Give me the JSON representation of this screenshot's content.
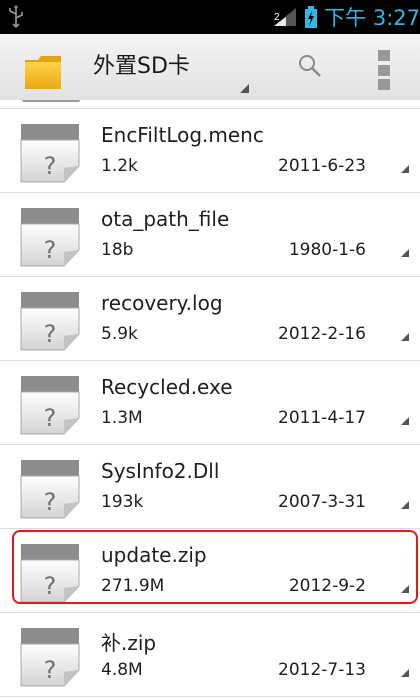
{
  "status_bar": {
    "time": "下午 3:27",
    "icons": [
      "usb-icon",
      "signal-icon",
      "battery-charging-icon"
    ],
    "accent_color": "#33b5e5"
  },
  "action_bar": {
    "title": "外置SD卡",
    "icons": [
      "folder-icon",
      "search-icon",
      "overflow-menu-icon"
    ]
  },
  "files": [
    {
      "name": "EncFiltLog.menc",
      "size": "1.2k",
      "date": "2011-6-23"
    },
    {
      "name": "ota_path_file",
      "size": "18b",
      "date": "1980-1-6"
    },
    {
      "name": "recovery.log",
      "size": "5.9k",
      "date": "2012-2-16"
    },
    {
      "name": "Recycled.exe",
      "size": "1.3M",
      "date": "2011-4-17"
    },
    {
      "name": "SysInfo2.Dll",
      "size": "193k",
      "date": "2007-3-31"
    },
    {
      "name": "update.zip",
      "size": "271.9M",
      "date": "2012-9-2",
      "highlighted": true
    },
    {
      "name": "补.zip",
      "size": "4.8M",
      "date": "2012-7-13"
    }
  ],
  "highlight_color": "#e11b1b"
}
